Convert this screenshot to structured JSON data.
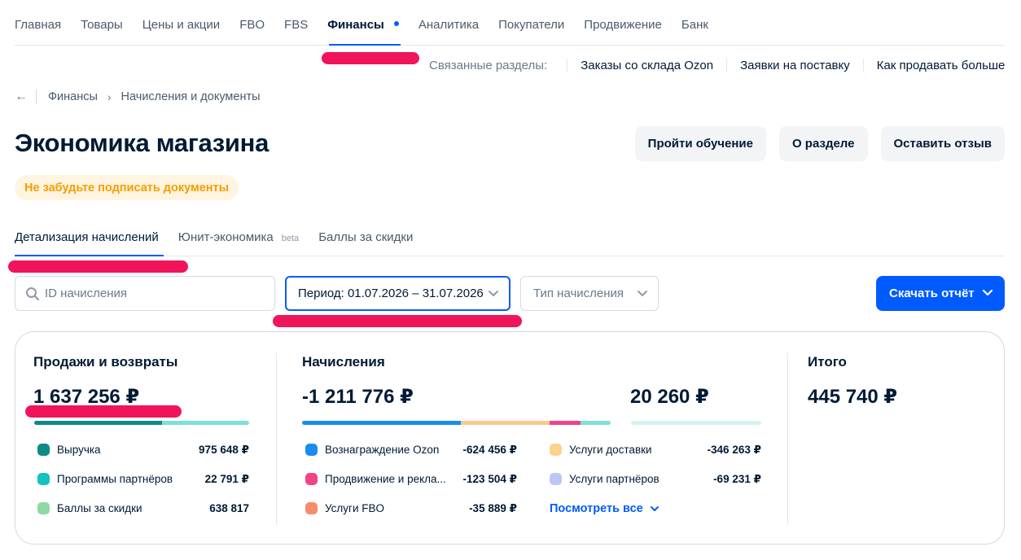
{
  "nav": {
    "items": [
      "Главная",
      "Товары",
      "Цены и акции",
      "FBO",
      "FBS",
      "Финансы",
      "Аналитика",
      "Покупатели",
      "Продвижение",
      "Банк"
    ],
    "active": "Финансы"
  },
  "related": {
    "label": "Связанные разделы:",
    "links": [
      "Заказы со склада Ozon",
      "Заявки на поставку",
      "Как продавать больше"
    ]
  },
  "breadcrumb": [
    "Финансы",
    "Начисления и документы"
  ],
  "page_title": "Экономика магазина",
  "header_buttons": [
    "Пройти обучение",
    "О разделе",
    "Оставить отзыв"
  ],
  "notice": "Не забудьте подписать документы",
  "tabs": [
    {
      "label": "Детализация начислений",
      "badge": ""
    },
    {
      "label": "Юнит-экономика",
      "badge": "beta"
    },
    {
      "label": "Баллы за скидки",
      "badge": ""
    }
  ],
  "filters": {
    "search_placeholder": "ID начисления",
    "period_label": "Период: 01.07.2026 – 31.07.2026",
    "type_placeholder": "Тип начисления",
    "download_label": "Скачать отчёт"
  },
  "summary": {
    "sales": {
      "title": "Продажи и возвраты",
      "total": "1 637 256 ₽",
      "rows": [
        {
          "label": "Выручка",
          "value": "975 648 ₽",
          "color": "#0e8a87"
        },
        {
          "label": "Программы партнёров",
          "value": "22 791 ₽",
          "color": "#13c2c2"
        },
        {
          "label": "Баллы за скидки",
          "value": "638 817",
          "color": "#8ed9a4"
        }
      ],
      "bar": [
        {
          "color": "#0e8a87",
          "share": 0.596
        },
        {
          "color": "#7fe0d8",
          "share": 0.404
        }
      ]
    },
    "charges": {
      "title": "Начисления",
      "total": "-1 211 776 ₽",
      "secondary_total": "20 260 ₽",
      "rows_left": [
        {
          "label": "Вознаграждение Ozon",
          "value": "-624 456 ₽",
          "color": "#1a8cf0"
        },
        {
          "label": "Продвижение и рекла...",
          "value": "-123 504 ₽",
          "color": "#f0448a"
        },
        {
          "label": "Услуги FBO",
          "value": "-35 889 ₽",
          "color": "#f58d6a"
        }
      ],
      "rows_right": [
        {
          "label": "Услуги доставки",
          "value": "-346 263 ₽",
          "color": "#fbd38f"
        },
        {
          "label": "Услуги партнёров",
          "value": "-69 231 ₽",
          "color": "#bcc6f7"
        }
      ],
      "see_all": "Посмотреть все",
      "bar": [
        {
          "color": "#1a8cf0",
          "share": 0.515
        },
        {
          "color": "#fbc98a",
          "share": 0.286
        },
        {
          "color": "#f0448a",
          "share": 0.102
        },
        {
          "color": "#7fe0d8",
          "share": 0.097
        }
      ],
      "secondary_bar_color": "#d3f3f1"
    },
    "total": {
      "title": "Итого",
      "value": "445 740 ₽"
    }
  }
}
